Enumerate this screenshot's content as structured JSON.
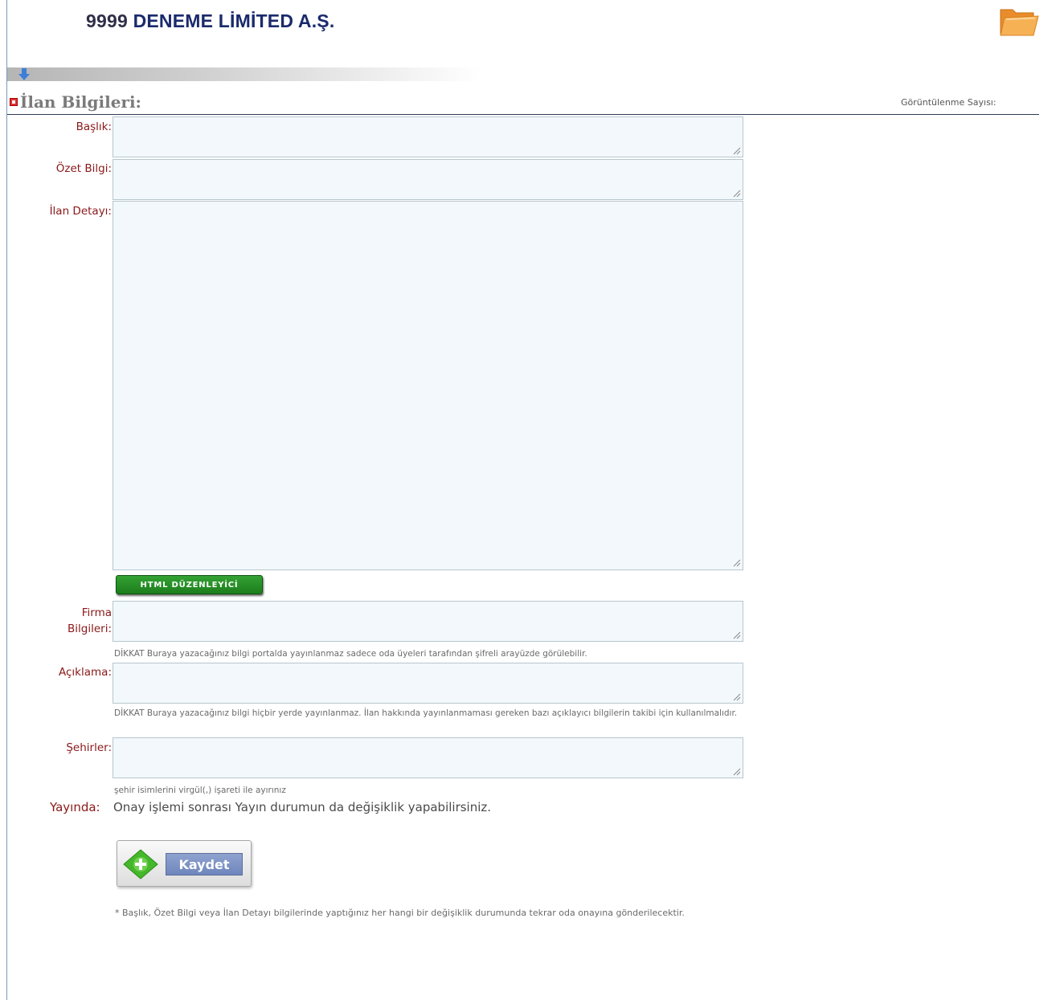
{
  "header": {
    "company_number": "9999",
    "company_name": "DENEME LİMİTED A.Ş."
  },
  "section": {
    "title": "İlan Bilgileri:",
    "view_count_label": "Görüntülenme Sayısı:"
  },
  "form": {
    "baslik_label": "Başlık:",
    "ozet_label": "Özet Bilgi:",
    "detay_label": "İlan Detayı:",
    "html_editor_button": "HTML DÜZENLEYİCİ",
    "firma_label_line1": "Firma",
    "firma_label_line2": "Bilgileri:",
    "firma_hint": "DİKKAT Buraya yazacağınız bilgi portalda yayınlanmaz sadece oda üyeleri tarafından şifreli arayüzde görülebilir.",
    "aciklama_label": "Açıklama:",
    "aciklama_hint": "DİKKAT Buraya yazacağınız bilgi hiçbir yerde yayınlanmaz. İlan hakkında yayınlanmaması gereken bazı açıklayıcı bilgilerin takibi için kullanılmalıdır.",
    "sehirler_label": "Şehirler:",
    "sehirler_hint": "şehir isimlerini virgül(,) işareti ile ayırınız",
    "yayinda_label": "Yayında:",
    "yayinda_text": "Onay işlemi sonrası Yayın durumun da değişiklik yapabilirsiniz.",
    "save_button": "Kaydet",
    "footnote": "* Başlık, Özet Bilgi veya İlan Detayı bilgilerinde yaptığınız her hangi bir değişiklik durumunda tekrar oda onayına gönderilecektir."
  },
  "colors": {
    "label": "#8a1818",
    "field_background": "#f2f8fb",
    "company": "#1a2a6c",
    "html_button": "#1c7d1c",
    "save_text_bg": "#7a90c4"
  }
}
